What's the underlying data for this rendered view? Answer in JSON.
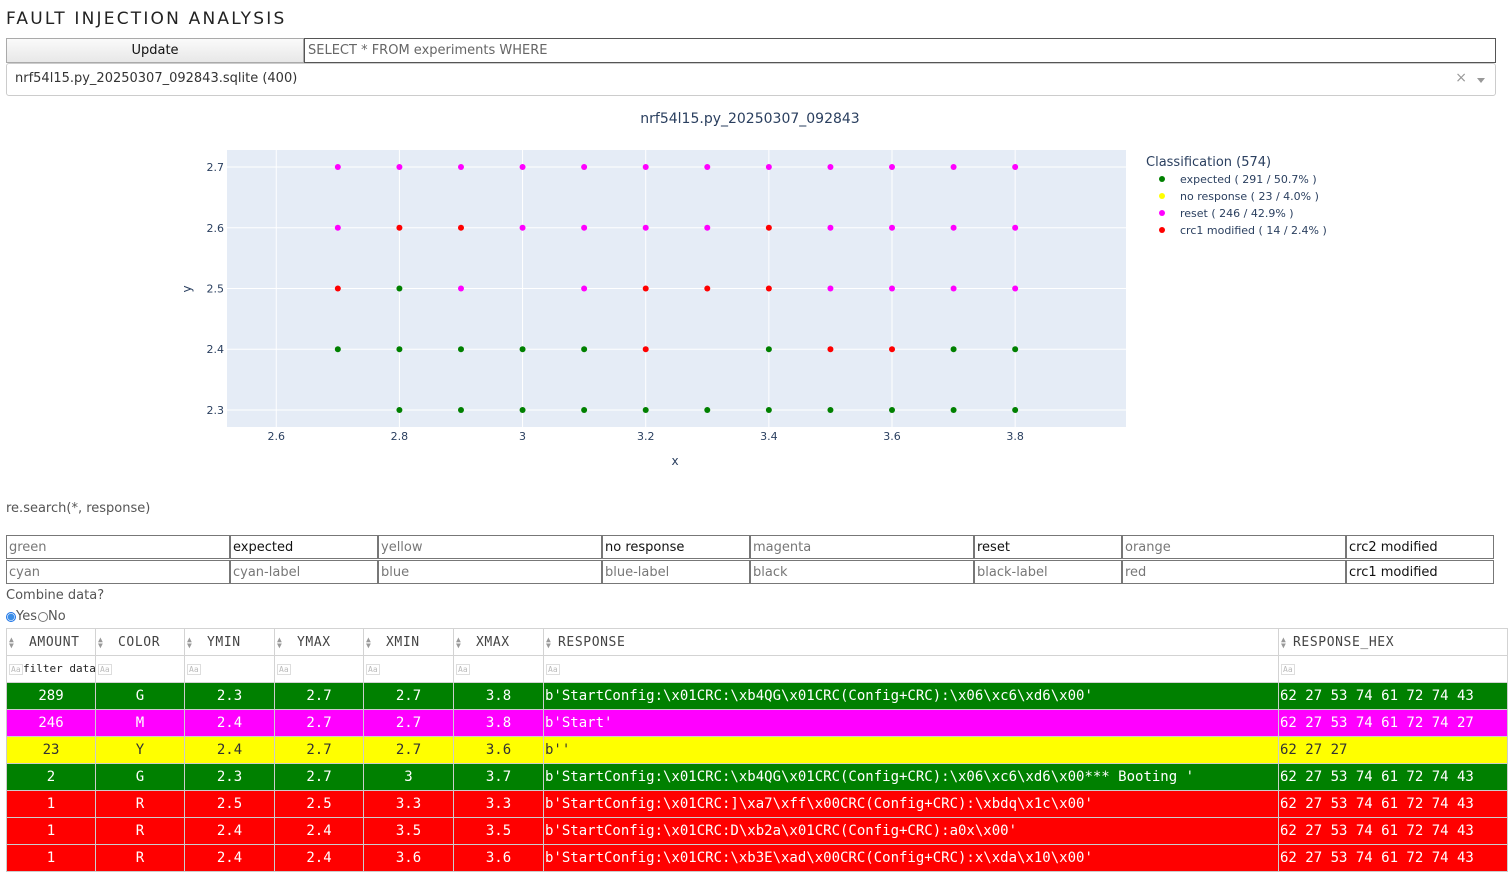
{
  "title": "FAULT INJECTION ANALYSIS",
  "update_label": "Update",
  "query_placeholder": "SELECT * FROM experiments WHERE",
  "db_select": {
    "value": "nrf54l15.py_20250307_092843.sqlite (400)",
    "clear": "×"
  },
  "chart_data": {
    "type": "scatter",
    "title": "nrf54l15.py_20250307_092843",
    "xlabel": "x",
    "ylabel": "y",
    "xlim": [
      2.52,
      3.98
    ],
    "ylim": [
      2.272,
      2.728
    ],
    "xticks": [
      2.6,
      2.8,
      3,
      3.2,
      3.4,
      3.6,
      3.8
    ],
    "yticks": [
      2.3,
      2.4,
      2.5,
      2.6,
      2.7
    ],
    "xtick_labels": [
      "2.6",
      "2.8",
      "3",
      "3.2",
      "3.4",
      "3.6",
      "3.8"
    ],
    "ytick_labels": [
      "2.3",
      "2.4",
      "2.5",
      "2.6",
      "2.7"
    ],
    "grid": true,
    "legend_position": "right",
    "legend_title": "Classification (574)",
    "series": [
      {
        "name": "expected ( 291 / 50.7% )",
        "color": "#008000",
        "points": [
          [
            2.8,
            2.3
          ],
          [
            2.9,
            2.3
          ],
          [
            3,
            2.3
          ],
          [
            3.1,
            2.3
          ],
          [
            3.2,
            2.3
          ],
          [
            3.3,
            2.3
          ],
          [
            3.4,
            2.3
          ],
          [
            3.5,
            2.3
          ],
          [
            3.6,
            2.3
          ],
          [
            3.7,
            2.3
          ],
          [
            3.8,
            2.3
          ],
          [
            2.7,
            2.4
          ],
          [
            2.8,
            2.4
          ],
          [
            2.9,
            2.4
          ],
          [
            3,
            2.4
          ],
          [
            3.1,
            2.4
          ],
          [
            3.4,
            2.4
          ],
          [
            3.7,
            2.4
          ],
          [
            3.8,
            2.4
          ],
          [
            2.8,
            2.5
          ]
        ]
      },
      {
        "name": "no response ( 23 / 4.0% )",
        "color": "#ffff00",
        "points": []
      },
      {
        "name": "reset ( 246 / 42.9% )",
        "color": "#ff00ff",
        "points": [
          [
            2.9,
            2.5
          ],
          [
            3.1,
            2.5
          ],
          [
            3.5,
            2.5
          ],
          [
            3.6,
            2.5
          ],
          [
            3.7,
            2.5
          ],
          [
            3.8,
            2.5
          ],
          [
            2.7,
            2.6
          ],
          [
            3,
            2.6
          ],
          [
            3.1,
            2.6
          ],
          [
            3.2,
            2.6
          ],
          [
            3.3,
            2.6
          ],
          [
            3.5,
            2.6
          ],
          [
            3.6,
            2.6
          ],
          [
            3.7,
            2.6
          ],
          [
            3.8,
            2.6
          ],
          [
            2.7,
            2.7
          ],
          [
            2.8,
            2.7
          ],
          [
            2.9,
            2.7
          ],
          [
            3,
            2.7
          ],
          [
            3.1,
            2.7
          ],
          [
            3.2,
            2.7
          ],
          [
            3.3,
            2.7
          ],
          [
            3.4,
            2.7
          ],
          [
            3.5,
            2.7
          ],
          [
            3.6,
            2.7
          ],
          [
            3.7,
            2.7
          ],
          [
            3.8,
            2.7
          ]
        ]
      },
      {
        "name": "crc1 modified ( 14 / 2.4% )",
        "color": "#ff0000",
        "points": [
          [
            3.2,
            2.4
          ],
          [
            3.5,
            2.4
          ],
          [
            3.6,
            2.4
          ],
          [
            2.7,
            2.5
          ],
          [
            3.2,
            2.5
          ],
          [
            3.3,
            2.5
          ],
          [
            3.4,
            2.5
          ],
          [
            2.8,
            2.6
          ],
          [
            2.9,
            2.6
          ],
          [
            3.4,
            2.6
          ]
        ]
      }
    ]
  },
  "search_label": "re.search(*, response)",
  "classifier_rows": [
    [
      {
        "color_value": "",
        "color_placeholder": "green",
        "label_value": "expected",
        "label_placeholder": ""
      },
      {
        "color_value": "",
        "color_placeholder": "yellow",
        "label_value": "no response",
        "label_placeholder": ""
      },
      {
        "color_value": "",
        "color_placeholder": "magenta",
        "label_value": "reset",
        "label_placeholder": ""
      },
      {
        "color_value": "",
        "color_placeholder": "orange",
        "label_value": "crc2 modified",
        "label_placeholder": ""
      }
    ],
    [
      {
        "color_value": "",
        "color_placeholder": "cyan",
        "label_value": "",
        "label_placeholder": "cyan-label"
      },
      {
        "color_value": "",
        "color_placeholder": "blue",
        "label_value": "",
        "label_placeholder": "blue-label"
      },
      {
        "color_value": "",
        "color_placeholder": "black",
        "label_value": "",
        "label_placeholder": "black-label"
      },
      {
        "color_value": "",
        "color_placeholder": "red",
        "label_value": "crc1 modified",
        "label_placeholder": ""
      }
    ]
  ],
  "combine": {
    "label": "Combine data?",
    "options": [
      "Yes",
      "No"
    ],
    "selected": "Yes"
  },
  "table": {
    "columns": [
      "AMOUNT",
      "COLOR",
      "YMIN",
      "YMAX",
      "XMIN",
      "XMAX",
      "RESPONSE",
      "RESPONSE_HEX"
    ],
    "filter_placeholder": "filter data...",
    "case_label": "Aa",
    "row_colors": {
      "G": "#008000",
      "M": "#ff00ff",
      "Y": "#ffff00",
      "R": "#ff0000"
    },
    "text_colors": {
      "G": "#ffffff",
      "M": "#ffffff",
      "Y": "#333333",
      "R": "#ffffff"
    },
    "rows": [
      {
        "amount": "289",
        "color": "G",
        "ymin": "2.3",
        "ymax": "2.7",
        "xmin": "2.7",
        "xmax": "3.8",
        "response": "b'StartConfig:\\x01CRC:\\xb4QG\\x01CRC(Config+CRC):\\x06\\xc6\\xd6\\x00'",
        "response_hex": "62 27 53 74 61 72 74 43"
      },
      {
        "amount": "246",
        "color": "M",
        "ymin": "2.4",
        "ymax": "2.7",
        "xmin": "2.7",
        "xmax": "3.8",
        "response": "b'Start'",
        "response_hex": "62 27 53 74 61 72 74 27"
      },
      {
        "amount": "23",
        "color": "Y",
        "ymin": "2.4",
        "ymax": "2.7",
        "xmin": "2.7",
        "xmax": "3.6",
        "response": "b''",
        "response_hex": "62 27 27"
      },
      {
        "amount": "2",
        "color": "G",
        "ymin": "2.3",
        "ymax": "2.7",
        "xmin": "3",
        "xmax": "3.7",
        "response": "b'StartConfig:\\x01CRC:\\xb4QG\\x01CRC(Config+CRC):\\x06\\xc6\\xd6\\x00*** Booting '",
        "response_hex": "62 27 53 74 61 72 74 43"
      },
      {
        "amount": "1",
        "color": "R",
        "ymin": "2.5",
        "ymax": "2.5",
        "xmin": "3.3",
        "xmax": "3.3",
        "response": "b'StartConfig:\\x01CRC:]\\xa7\\xff\\x00CRC(Config+CRC):\\xbdq\\x1c\\x00'",
        "response_hex": "62 27 53 74 61 72 74 43"
      },
      {
        "amount": "1",
        "color": "R",
        "ymin": "2.4",
        "ymax": "2.4",
        "xmin": "3.5",
        "xmax": "3.5",
        "response": "b'StartConfig:\\x01CRC:D\\xb2a\\x01CRC(Config+CRC):a0x\\x00'",
        "response_hex": "62 27 53 74 61 72 74 43"
      },
      {
        "amount": "1",
        "color": "R",
        "ymin": "2.4",
        "ymax": "2.4",
        "xmin": "3.6",
        "xmax": "3.6",
        "response": "b'StartConfig:\\x01CRC:\\xb3E\\xad\\x00CRC(Config+CRC):x\\xda\\x10\\x00'",
        "response_hex": "62 27 53 74 61 72 74 43"
      }
    ]
  }
}
